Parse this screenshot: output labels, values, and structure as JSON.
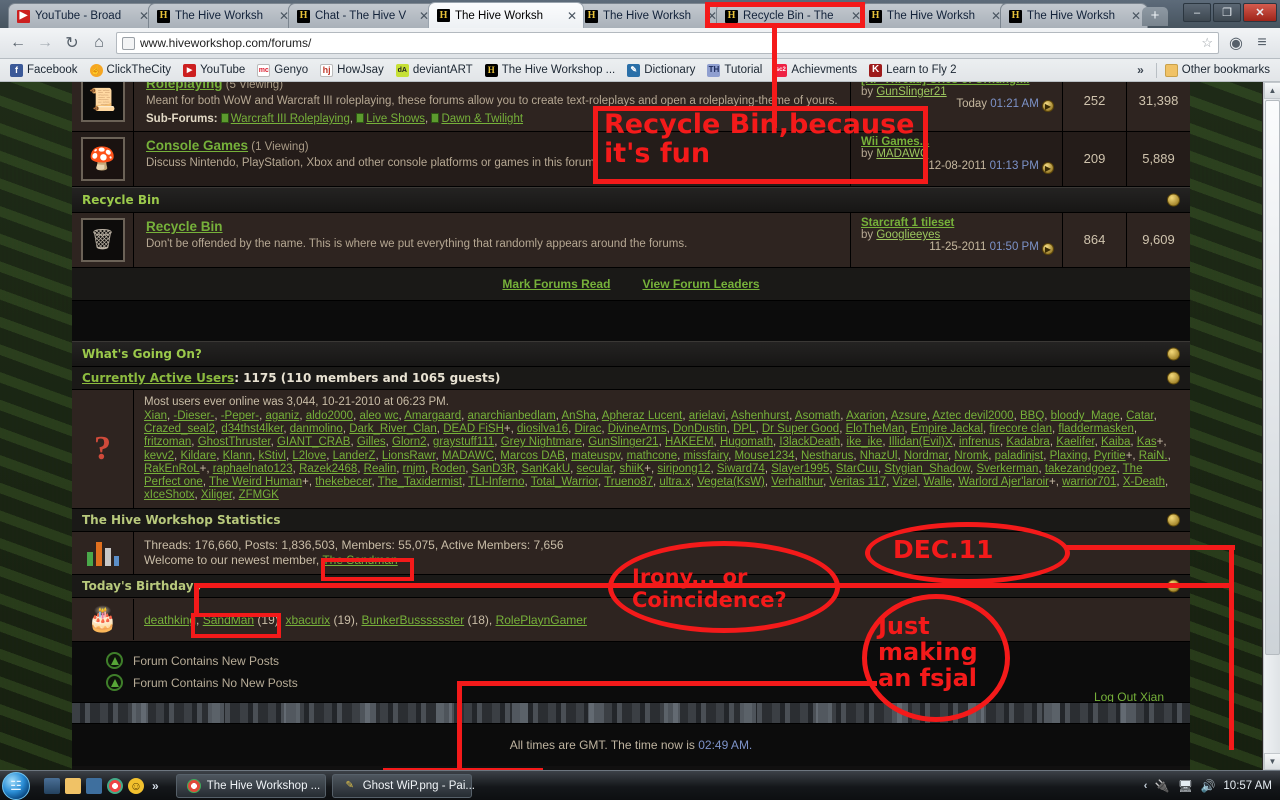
{
  "browser": {
    "tabs": [
      {
        "title": "YouTube - Broad",
        "favicon": "youtube-icon",
        "active": false
      },
      {
        "title": "The Hive Worksh",
        "favicon": "hive-icon",
        "active": false
      },
      {
        "title": "Chat - The Hive V",
        "favicon": "hive-icon",
        "active": false
      },
      {
        "title": "The Hive Worksh",
        "favicon": "hive-icon",
        "active": true
      },
      {
        "title": "The Hive Worksh",
        "favicon": "hive-icon",
        "active": false
      },
      {
        "title": "Recycle Bin - The",
        "favicon": "hive-icon",
        "active": false
      },
      {
        "title": "The Hive Worksh",
        "favicon": "hive-icon",
        "active": false
      },
      {
        "title": "The Hive Worksh",
        "favicon": "hive-icon",
        "active": false
      }
    ],
    "new_tab_label": "+",
    "window_buttons": {
      "minimize": "–",
      "maximize": "❐",
      "close": "✕"
    },
    "toolbar": {
      "back": "←",
      "forward": "→",
      "reload": "↻",
      "home": "⌂",
      "url": "www.hiveworkshop.com/forums/",
      "star": "☆",
      "extension1": "◉",
      "wrench": "≡"
    },
    "bookmarks": [
      {
        "label": "Facebook",
        "icon": "facebook-icon",
        "glyph": "f"
      },
      {
        "label": "ClickTheCity",
        "icon": "clickthecity-icon",
        "glyph": "☝"
      },
      {
        "label": "YouTube",
        "icon": "youtube-icon",
        "glyph": "▶"
      },
      {
        "label": "Genyo",
        "icon": "genyo-icon",
        "glyph": "mc"
      },
      {
        "label": "HowJsay",
        "icon": "howjsay-icon",
        "glyph": "hj"
      },
      {
        "label": "deviantART",
        "icon": "deviantart-icon",
        "glyph": "dA"
      },
      {
        "label": "The Hive Workshop ...",
        "icon": "hive-icon",
        "glyph": "H"
      },
      {
        "label": "Dictionary",
        "icon": "dictionary-icon",
        "glyph": "✎"
      },
      {
        "label": "Tutorial",
        "icon": "tutorial-icon",
        "glyph": "TH"
      },
      {
        "label": "Achievments",
        "icon": "achievements-icon",
        "glyph": "sc2"
      },
      {
        "label": "Learn to Fly 2",
        "icon": "learntofly-icon",
        "glyph": "K"
      }
    ],
    "bookmarks_overflow": "»",
    "other_bookmarks": "Other bookmarks"
  },
  "forum": {
    "rows_top": [
      {
        "icon": "scrolls-icon",
        "glyph": "📜",
        "title": "Roleplaying",
        "viewing": "(5 Viewing)",
        "desc": "Meant for both WoW and Warcraft III roleplaying, these forums allow you to create text-roleplays and open a roleplaying-theme of yours.",
        "subforums_label": "Sub-Forums:",
        "subforums": [
          "Warcraft III Roleplaying",
          "Live Shows",
          "Dawn & Twilight"
        ],
        "last_title": "[RP Thread] Cries of Urnung:...",
        "last_by_label": "by",
        "last_by": "GunSlinger21",
        "last_date": "Today",
        "last_time": "01:21 AM",
        "threads": "252",
        "posts": "31,398"
      },
      {
        "icon": "mario-icon",
        "glyph": "🍄",
        "title": "Console Games",
        "viewing": "(1 Viewing)",
        "desc": "Discuss Nintendo, PlayStation, Xbox and other console platforms or games in this forum.",
        "subforums_label": "",
        "subforums": [],
        "last_title": "Wii Games...",
        "last_by_label": "by",
        "last_by": "MADAWC",
        "last_date": "12-08-2011",
        "last_time": "01:13 PM",
        "threads": "209",
        "posts": "5,889"
      }
    ],
    "recycle_category": "Recycle Bin",
    "recycle_row": {
      "icon": "recycle-bin-icon",
      "glyph": "🗑",
      "title": "Recycle Bin",
      "viewing": "",
      "desc": "Don't be offended by the name. This is where we put everything that randomly appears around the forums.",
      "last_title": "Starcraft 1 tileset",
      "last_by_label": "by",
      "last_by": "Googlieeyes",
      "last_date": "11-25-2011",
      "last_time": "01:50 PM",
      "threads": "864",
      "posts": "9,609"
    },
    "footer_links": [
      "Mark Forums Read",
      "View Forum Leaders"
    ],
    "whats_going_on": "What's Going On?",
    "active_users": {
      "link_label": "Currently Active Users",
      "summary": ": 1175 (110 members and 1065 guests)",
      "icon": "question-mark-icon",
      "glyph": "?",
      "most_ever": "Most users ever online was 3,044, 10-21-2010 at 06:23 PM.",
      "names": "Xian, -Dieser-, -Peper-, aganiz, aldo2000, aleo wc, Amargaard, anarchianbedlam, AnSha, Apheraz Lucent, arielavi, Ashenhurst, Asomath, Axarion, Azsure, Aztec devil2000, BBQ, bloody_Mage, Catar, Crazed_seal2, d34thst4lker, danmolino, Dark_River_Clan, DEAD FiSH+, diosilva16, Dirac, DivineArms, DonDustin, DPL, Dr Super Good, EloTheMan, Empire Jackal, firecore clan, fladdermasken, fritzoman, GhostThruster, GIANT_CRAB, Gilles, Glorn2, graystuff111, Grey Nightmare, GunSlinger21, HAKEEM, Hugomath, I3lackDeath, ike_ike, Illidan(Evil)X, infrenus, Kadabra, Kaelifer, Kaiba, Kas+, kevv2, Kildare, Klann, kStivl, L2love, LanderZ, LionsRawr, MADAWC, Marcos DAB, mateuspv, mathcone, missfairy, Mouse1234, Nestharus, NhazUl, Nordmar, Nromk, paladinjst, Plaxing, Pyritie+, RaiN., RakEnRoL+, raphaelnato123, Razek2468, Realin, rnjm, Roden, SanD3R, SanKakU, secular, shiiK+, siripong12, Siward74, Slayer1995, StarCuu, Stygian_Shadow, Sverkerman, takezandgoez, The Perfect one, The Weird Human+, thekebecer, The_Taxidermist, TLI-Inferno, Total_Warrior, Trueno87, ultra.x, Vegeta(KsW), Verhalthur, Veritas 117, Vizel, Walle, Warlord Ajer'laroir+, warrior701, X-Death, xIceShotx, Xiliger, ZFMGK"
    },
    "statistics": {
      "heading": "The Hive Workshop Statistics",
      "icon": "bar-chart-icon",
      "line1": "Threads: 176,660, Posts: 1,836,503, Members: 55,075, Active Members: 7,656",
      "line2_prefix": "Welcome to our newest member,",
      "newest_member": "The Sandman"
    },
    "birthdays": {
      "heading": "Today's Birthdays",
      "icon": "birthday-cake-icon",
      "glyph": "🎂",
      "entries": [
        {
          "name": "deathking",
          "age": ""
        },
        {
          "name": "SandMan",
          "age": "(19)"
        },
        {
          "name": "xbacurix",
          "age": "(19)"
        },
        {
          "name": "BunkerBusssssster",
          "age": "(18)"
        },
        {
          "name": "RolePlaynGamer",
          "age": ""
        }
      ]
    },
    "legend": [
      {
        "label": "Forum Contains New Posts",
        "icon": "new-posts-icon"
      },
      {
        "label": "Forum Contains No New Posts",
        "icon": "no-new-posts-icon"
      }
    ],
    "logout": "Log Out Xian",
    "gmt_prefix": "All times are GMT. The time now is",
    "gmt_time": "02:49 AM.",
    "gmt_suffix": ""
  },
  "annotations": {
    "color": "#f41a1a",
    "items": [
      {
        "id": "recycle-tab-highlight",
        "type": "box",
        "text": ""
      },
      {
        "id": "recycle-bin-because",
        "type": "box-text",
        "text": "Recycle Bin,because\nit's fun"
      },
      {
        "id": "sandman-stats-box",
        "type": "box",
        "text": ""
      },
      {
        "id": "sandman-birthday-box",
        "type": "box",
        "text": ""
      },
      {
        "id": "irony-or-coincidence",
        "type": "ellipse-text",
        "text": "Irony... or\nCoincidence?"
      },
      {
        "id": "dec-11",
        "type": "ellipse-text",
        "text": "DEC.11"
      },
      {
        "id": "just-making-an-fsjal",
        "type": "ellipse-text",
        "text": "Just\nmaking\nan fsjal"
      },
      {
        "id": "paint-task-highlight",
        "type": "box",
        "text": ""
      }
    ]
  },
  "taskbar": {
    "start": "start-orb",
    "quick_launch": [
      {
        "icon": "show-desktop-icon"
      },
      {
        "icon": "folder-icon"
      },
      {
        "icon": "messenger-icon"
      },
      {
        "icon": "chrome-icon"
      },
      {
        "icon": "smiley-icon"
      }
    ],
    "overflow": "»",
    "buttons": [
      {
        "label": "The Hive Workshop ...",
        "icon": "chrome-icon"
      },
      {
        "label": "Ghost WiP.png - Pai...",
        "icon": "paint-icon"
      }
    ],
    "tray": [
      {
        "icon": "tray-chevron-icon",
        "glyph": "‹"
      },
      {
        "icon": "usb-eject-icon",
        "glyph": "🔌"
      },
      {
        "icon": "network-icon",
        "glyph": "🖧"
      },
      {
        "icon": "volume-icon",
        "glyph": "🔊"
      }
    ],
    "clock": "10:57 AM"
  }
}
